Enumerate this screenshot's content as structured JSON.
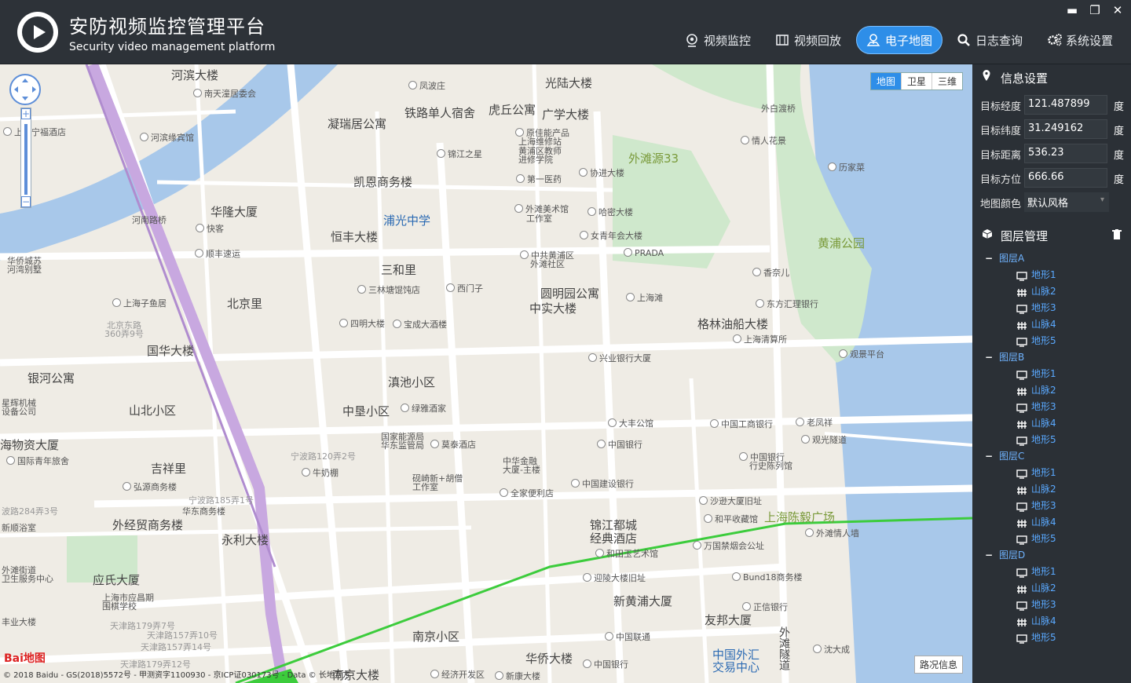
{
  "app": {
    "title": "安防视频监控管理平台",
    "subtitle": "Security video management platform"
  },
  "window_controls": {
    "minimize": "▬",
    "restore": "❐",
    "close": "✕"
  },
  "nav": [
    {
      "label": "视频监控",
      "icon": "camera-icon",
      "active": false
    },
    {
      "label": "视频回放",
      "icon": "film-icon",
      "active": false
    },
    {
      "label": "电子地图",
      "icon": "map-pin-icon",
      "active": true
    },
    {
      "label": "日志查询",
      "icon": "search-icon",
      "active": false
    },
    {
      "label": "系统设置",
      "icon": "gears-icon",
      "active": false
    }
  ],
  "map": {
    "types": [
      "地图",
      "卫星",
      "三维"
    ],
    "active_type": "地图",
    "road_info_button": "路况信息",
    "copyright": "© 2018 Baidu - GS(2018)5572号 - 甲测资字1100930 - 京ICP证030173号 - Data © 长地万方",
    "baidu_logo": "Bai地图",
    "colors": {
      "water": "#a8c8ea",
      "park": "#cfe8cc",
      "road": "#ffffff",
      "metro": "#c8a8e0",
      "route": "#3ccc3c"
    },
    "labels_big": [
      "河滨大楼",
      "光陆大楼",
      "凝瑞居公寓",
      "铁路单人宿舍",
      "虎丘公寓",
      "广学大楼",
      "外滩源33",
      "凯恩商务楼",
      "华隆大厦",
      "浦光中学",
      "恒丰大楼",
      "三和里",
      "黄浦公园",
      "北京里",
      "圆明园公寓",
      "中实大楼",
      "格林油船大楼",
      "国华大楼",
      "银河公寓",
      "滇池小区",
      "山北小区",
      "中垦小区",
      "海物资大厦",
      "吉祥里",
      "外经贸商务楼",
      "永利大楼",
      "锦江都城",
      "经典酒店",
      "上海陈毅广场",
      "应氏大厦",
      "新黄浦大厦",
      "友邦大厦",
      "南京小区",
      "华侨大楼",
      "中国外汇",
      "交易中心",
      "南京大楼",
      "外滩隧道"
    ],
    "labels_poi": [
      "南天潼居委会",
      "凤波庄",
      "河滨缘宾馆",
      "上海宁福酒店",
      "锦江之星",
      "原佳能产品",
      "上海维修站",
      "黄浦区教师",
      "进修学院",
      "外白渡桥",
      "情人花景",
      "历家菜",
      "第一医药",
      "协进大楼",
      "外滩美术馆",
      "工作室",
      "哈密大楼",
      "女青年会大楼",
      "河南路桥",
      "快客",
      "顺丰速运",
      "中共黄浦区",
      "外滩社区",
      "PRADA",
      "香奈儿",
      "华侨城苏",
      "河湾别墅",
      "三林塘馄饨店",
      "西门子",
      "上海滩",
      "东方汇理银行",
      "上海子鱼居",
      "北京东路",
      "360弄9号",
      "四明大楼",
      "宝成大酒楼",
      "上海清算所",
      "兴业银行大厦",
      "观景平台",
      "星辉机械",
      "设备公司",
      "绿雅酒家",
      "大丰公馆",
      "中国工商银行",
      "老凤祥",
      "国际青年旅舍",
      "国家能源局",
      "华东监管局",
      "莫泰酒店",
      "中国银行",
      "观光隧道",
      "宁波路120弄2号",
      "中华金融",
      "大厦-主楼",
      "中国银行",
      "行史陈列馆",
      "牛奶棚",
      "弘源商务楼",
      "砚崎新+胡僧",
      "工作室",
      "中国建设银行",
      "宁波路185弄1号",
      "全家便利店",
      "沙逊大厦旧址",
      "华东商务楼",
      "波路284弄3号",
      "和平收藏馆",
      "新顺浴室",
      "外滩情人墙",
      "万国禁烟会公址",
      "外滩街道",
      "卫生服务中心",
      "和田玉艺术馆",
      "迎陵大楼旧址",
      "Bund18商务楼",
      "上海市应昌期",
      "围棋学校",
      "丰业大楼",
      "正信银行",
      "天津路179弄7号",
      "天津路157弄10号",
      "天津路157弄14号",
      "中国联通",
      "沈大成",
      "天津路179弄12号",
      "经济开发区",
      "中国银行",
      "新康大楼"
    ]
  },
  "info_settings": {
    "title": "信息设置",
    "rows": [
      {
        "label": "目标经度",
        "value": "121.487899",
        "unit": "度"
      },
      {
        "label": "目标纬度",
        "value": "31.249162",
        "unit": "度"
      },
      {
        "label": "目标距离",
        "value": "536.23",
        "unit": "度"
      },
      {
        "label": "目标方位",
        "value": "666.66",
        "unit": "度"
      }
    ],
    "color_label": "地图颜色",
    "color_value": "默认风格"
  },
  "layer_mgmt": {
    "title": "图层管理",
    "groups": [
      {
        "name": "图层A",
        "items": [
          {
            "name": "地形1",
            "icon": "monitor-icon"
          },
          {
            "name": "山脉2",
            "icon": "grid-icon"
          },
          {
            "name": "地形3",
            "icon": "monitor-icon"
          },
          {
            "name": "山脉4",
            "icon": "grid-icon"
          },
          {
            "name": "地形5",
            "icon": "monitor-icon"
          }
        ]
      },
      {
        "name": "图层B",
        "items": [
          {
            "name": "地形1",
            "icon": "monitor-icon"
          },
          {
            "name": "山脉2",
            "icon": "grid-icon"
          },
          {
            "name": "地形3",
            "icon": "monitor-icon"
          },
          {
            "name": "山脉4",
            "icon": "grid-icon"
          },
          {
            "name": "地形5",
            "icon": "monitor-icon"
          }
        ]
      },
      {
        "name": "图层C",
        "items": [
          {
            "name": "地形1",
            "icon": "monitor-icon"
          },
          {
            "name": "山脉2",
            "icon": "grid-icon"
          },
          {
            "name": "地形3",
            "icon": "monitor-icon"
          },
          {
            "name": "山脉4",
            "icon": "grid-icon"
          },
          {
            "name": "地形5",
            "icon": "monitor-icon"
          }
        ]
      },
      {
        "name": "图层D",
        "items": [
          {
            "name": "地形1",
            "icon": "monitor-icon"
          },
          {
            "name": "山脉2",
            "icon": "grid-icon"
          },
          {
            "name": "地形3",
            "icon": "monitor-icon"
          },
          {
            "name": "山脉4",
            "icon": "grid-icon"
          },
          {
            "name": "地形5",
            "icon": "monitor-icon"
          }
        ]
      }
    ]
  }
}
